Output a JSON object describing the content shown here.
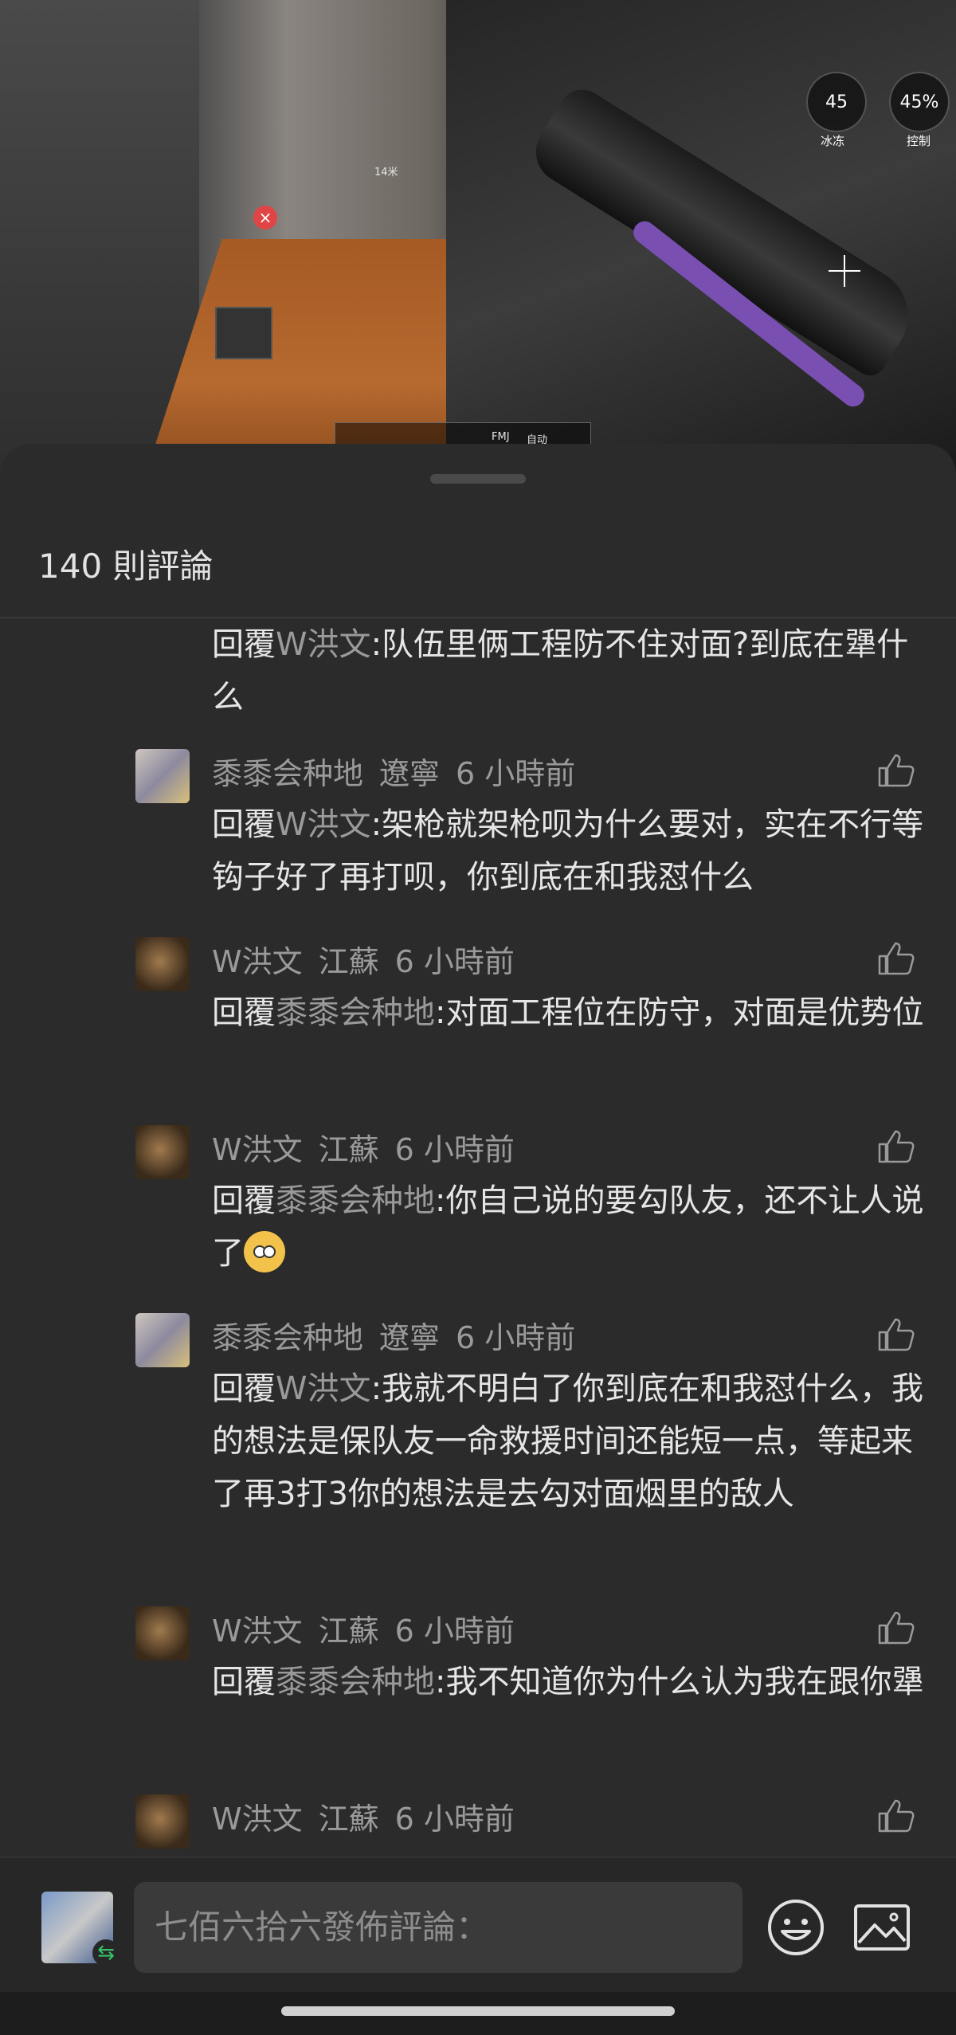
{
  "video": {
    "hud_freeze_value": "45",
    "hud_freeze_label": "冰冻",
    "hud_control_value": "45%",
    "hud_control_label": "控制",
    "distance_label": "14米",
    "ammo_mode": "FMJ",
    "fire_mode": "自动"
  },
  "sheet": {
    "comment_count": "140 則評論"
  },
  "comments": [
    {
      "reply_prefix": "回覆",
      "mention": "W洪文",
      "text": ":队伍里俩工程防不住对面?到底在犟什么"
    },
    {
      "author": "黍黍会种地",
      "location": "遼寧",
      "time": "6 小時前",
      "reply_prefix": "回覆",
      "mention": "W洪文",
      "text": ":架枪就架枪呗为什么要对，实在不行等钩子好了再打呗，你到底在和我怼什么"
    },
    {
      "author": "W洪文",
      "location": "江蘇",
      "time": "6 小時前",
      "reply_prefix": "回覆",
      "mention": "黍黍会种地",
      "text": ":对面工程位在防守，对面是优势位"
    },
    {
      "author": "W洪文",
      "location": "江蘇",
      "time": "6 小時前",
      "reply_prefix": "回覆",
      "mention": "黍黍会种地",
      "text": ":你自己说的要勾队友，还不让人说了"
    },
    {
      "author": "黍黍会种地",
      "location": "遼寧",
      "time": "6 小時前",
      "reply_prefix": "回覆",
      "mention": "W洪文",
      "text": ":我就不明白了你到底在和我怼什么，我的想法是保队友一命救援时间还能短一点，等起来了再3打3你的想法是去勾对面烟里的敌人"
    },
    {
      "author": "W洪文",
      "location": "江蘇",
      "time": "6 小時前",
      "reply_prefix": "回覆",
      "mention": "黍黍会种地",
      "text": ":我不知道你为什么认为我在跟你犟"
    },
    {
      "author": "W洪文",
      "location": "江蘇",
      "time": "6 小時前"
    }
  ],
  "input": {
    "placeholder": "七佰六拾六發佈評論："
  }
}
